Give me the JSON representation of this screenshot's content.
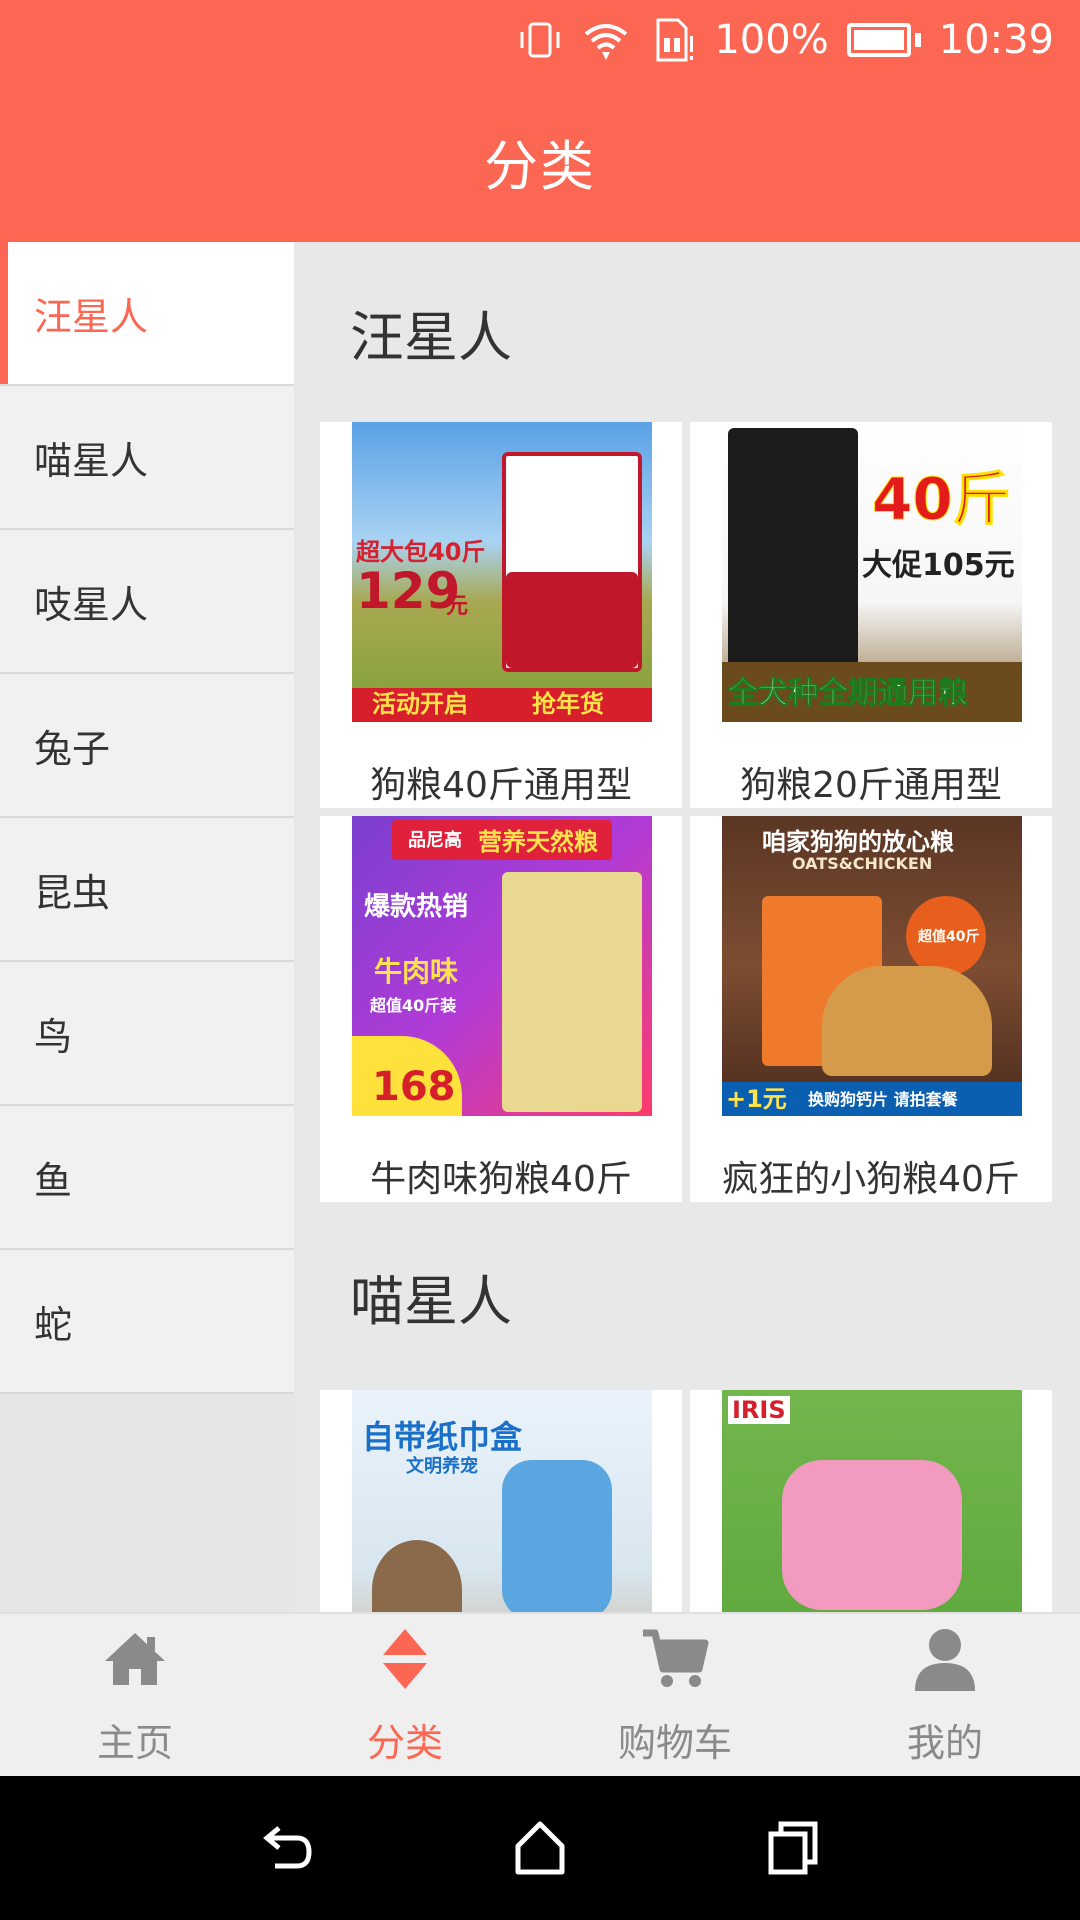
{
  "status_bar": {
    "battery": "100%",
    "time": "10:39",
    "icons": [
      "vibrate-icon",
      "wifi-icon",
      "sim-alert-icon",
      "battery-icon"
    ]
  },
  "header": {
    "title": "分类"
  },
  "sidebar": {
    "items": [
      {
        "label": "汪星人",
        "active": true
      },
      {
        "label": "喵星人"
      },
      {
        "label": "吱星人"
      },
      {
        "label": "兔子"
      },
      {
        "label": "昆虫"
      },
      {
        "label": "鸟"
      },
      {
        "label": "鱼"
      },
      {
        "label": "蛇"
      }
    ]
  },
  "sections": [
    {
      "title": "汪星人",
      "products": [
        {
          "name": "狗粮40斤通用型",
          "image_text": [
            "超大包40斤",
            "129",
            "元",
            "活动开启",
            "抢年货"
          ]
        },
        {
          "name": "狗粮20斤通用型",
          "image_text": [
            "40斤",
            "大促105元",
            "全犬种全期通用粮"
          ]
        },
        {
          "name": "牛肉味狗粮40斤",
          "image_text": [
            "品尼高",
            "营养天然粮",
            "爆款热销",
            "牛肉味",
            "超值40斤装",
            "168"
          ]
        },
        {
          "name": "疯狂的小狗粮40斤",
          "image_text": [
            "咱家狗狗的放心粮",
            "OATS&CHICKEN",
            "超值40斤",
            "+1元",
            "换购狗钙片 请拍套餐"
          ]
        }
      ]
    },
    {
      "title": "喵星人",
      "products": [
        {
          "name": "",
          "image_text": [
            "自带纸巾盒",
            "文明养宠"
          ]
        },
        {
          "name": "",
          "image_text": [
            "IRIS"
          ]
        }
      ]
    }
  ],
  "bottom_nav": [
    {
      "label": "主页",
      "icon": "home-icon"
    },
    {
      "label": "分类",
      "icon": "sort-icon",
      "active": true
    },
    {
      "label": "购物车",
      "icon": "cart-icon"
    },
    {
      "label": "我的",
      "icon": "user-icon"
    }
  ],
  "colors": {
    "accent": "#fc6753",
    "nav_inactive": "#8a8a8a"
  }
}
